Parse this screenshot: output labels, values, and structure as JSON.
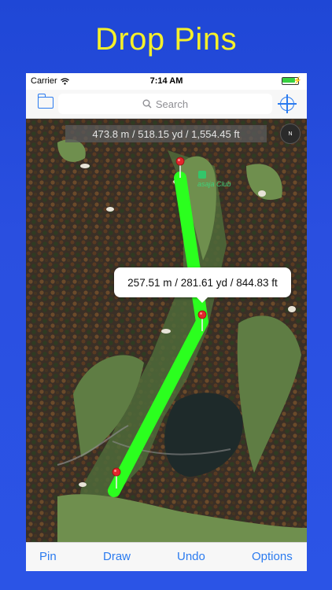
{
  "headline": "Drop Pins",
  "status": {
    "carrier": "Carrier",
    "time": "7:14 AM"
  },
  "search": {
    "placeholder": "Search"
  },
  "map": {
    "measurement": "473.8 m / 518.15 yd / 1,554.45 ft",
    "callout": "257.51 m / 281.61 yd / 844.83 ft",
    "place_label": "asaja Club"
  },
  "toolbar": {
    "pin": "Pin",
    "draw": "Draw",
    "undo": "Undo",
    "options": "Options"
  },
  "colors": {
    "route": "#2bff1e",
    "pin": "#e3262c",
    "accent": "#2b7bef",
    "headline": "#f5f02a"
  }
}
